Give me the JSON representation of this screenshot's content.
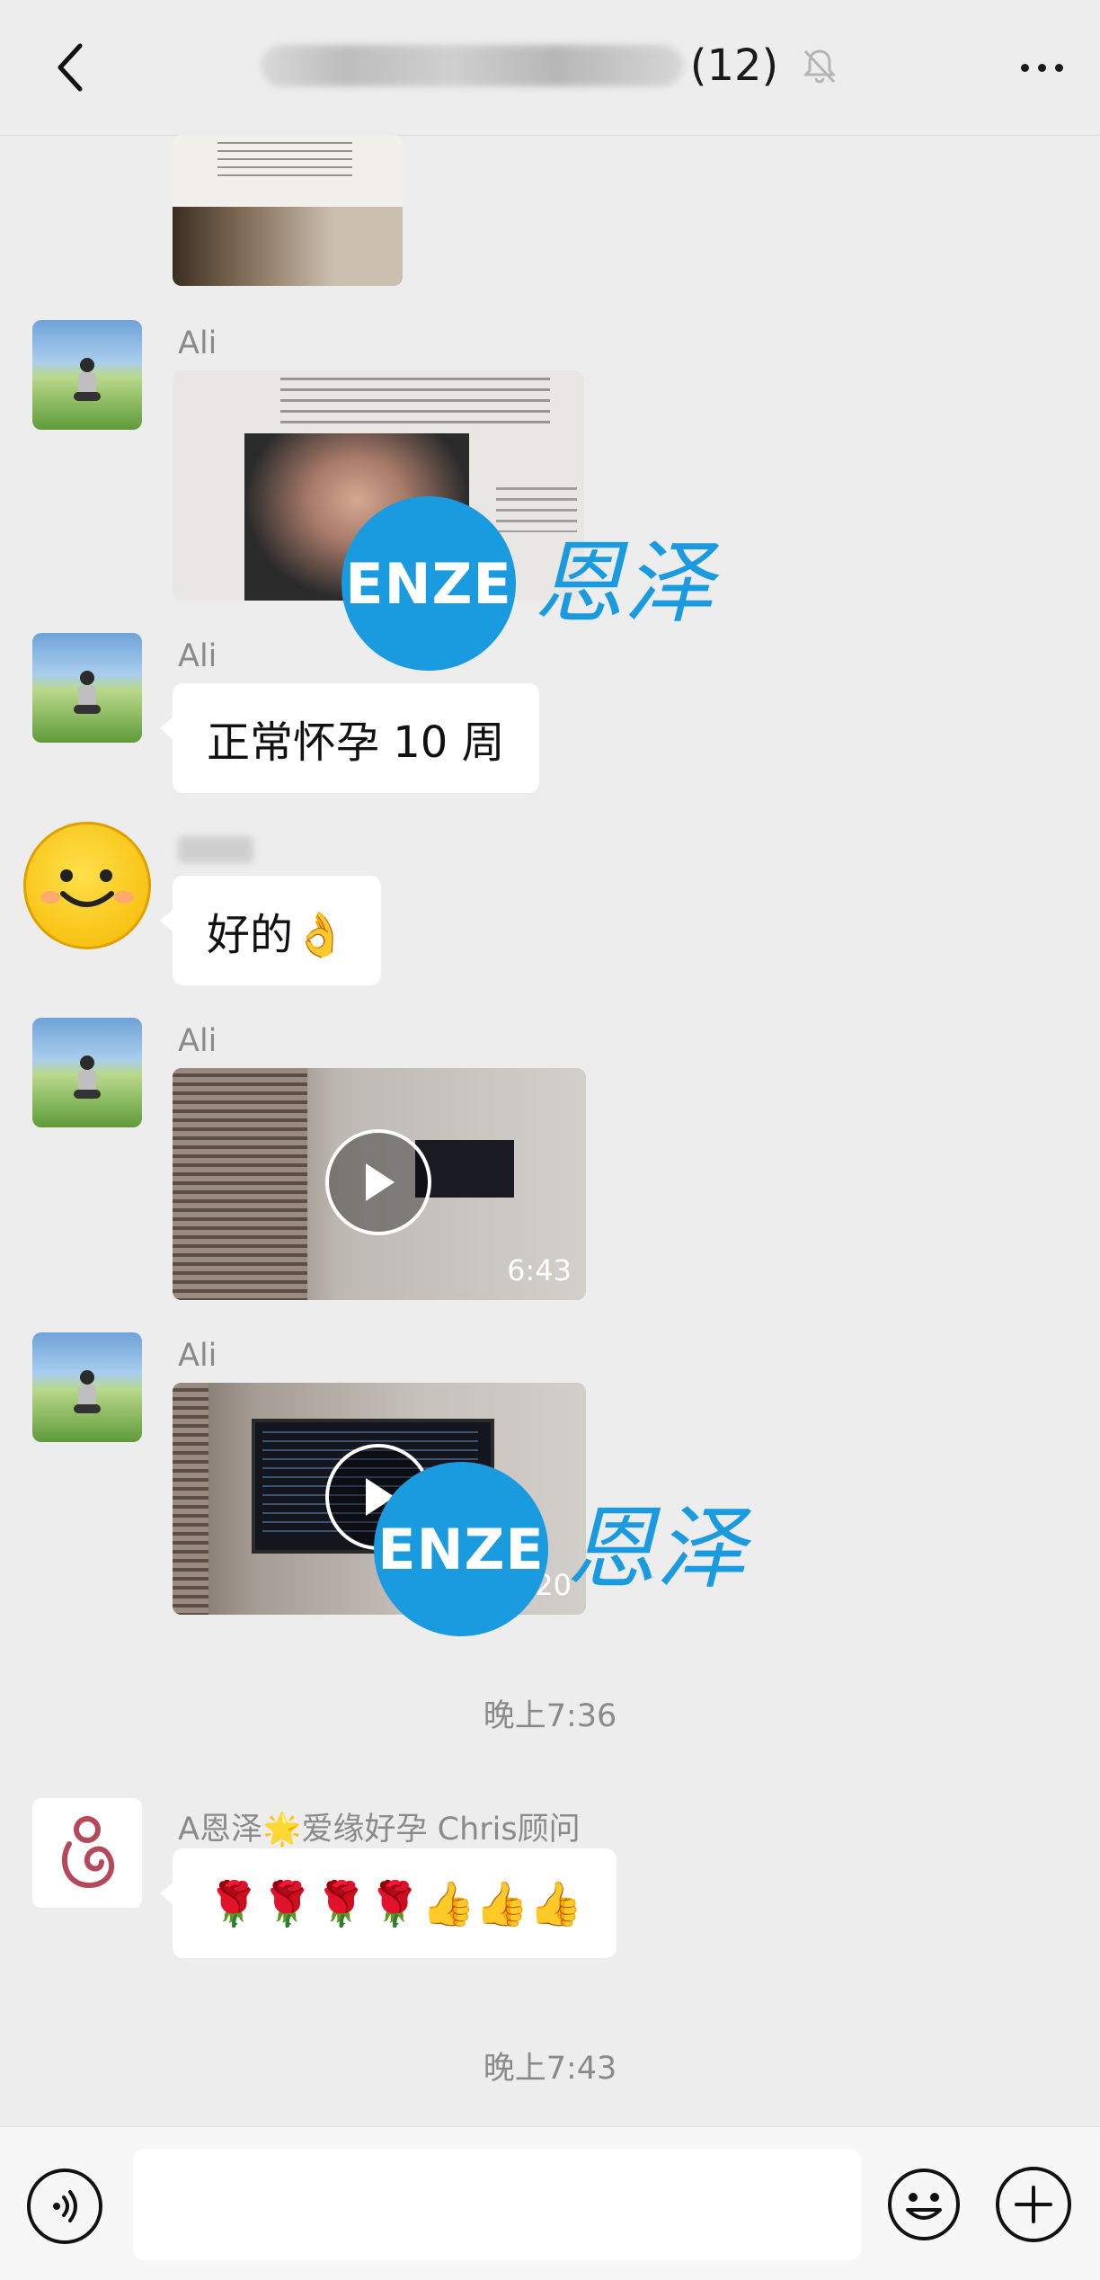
{
  "header": {
    "title_count": "(12)",
    "back_icon": "chevron-left-icon",
    "mute_icon": "bell-off-icon",
    "more_icon": "more-horizontal-icon"
  },
  "messages": [
    {
      "sender": "Ali",
      "type": "image",
      "description": "document image (top cropped)"
    },
    {
      "sender": "Ali",
      "type": "image",
      "description": "ultrasound report"
    },
    {
      "sender": "Ali",
      "type": "text",
      "text": "正常怀孕 10 周"
    },
    {
      "sender": "",
      "type": "text",
      "text": "好的👌"
    },
    {
      "sender": "Ali",
      "type": "video",
      "duration": "6:43"
    },
    {
      "sender": "Ali",
      "type": "video",
      "duration": "20"
    },
    {
      "sender": "A恩泽🌟爱缘好孕 Chris顾问",
      "type": "text",
      "text": "🌹🌹🌹🌹👍👍👍"
    }
  ],
  "timestamps": [
    "晚上7:36",
    "晚上7:43"
  ],
  "watermark": {
    "logo_text": "ENZE",
    "chinese": "恩泽",
    "color": "#1a9be0"
  },
  "footer": {
    "voice_icon": "voice-icon",
    "emoji_icon": "emoji-icon",
    "plus_icon": "plus-icon",
    "input_value": ""
  },
  "colors": {
    "background": "#ededed",
    "bubble": "#ffffff",
    "accent": "#1a9be0"
  }
}
